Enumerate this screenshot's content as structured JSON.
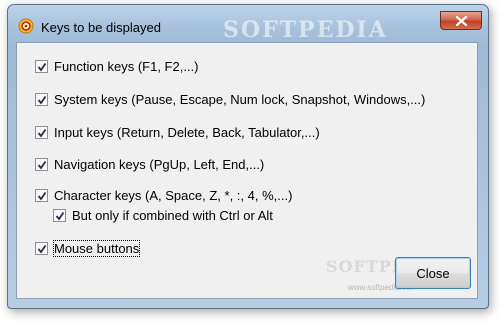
{
  "window": {
    "title": "Keys to be displayed"
  },
  "options": [
    {
      "label": "Function keys (F1, F2,...)",
      "checked": true
    },
    {
      "label": "System keys (Pause, Escape, Num lock, Snapshot, Windows,...)",
      "checked": true
    },
    {
      "label": "Input keys (Return, Delete, Back, Tabulator,...)",
      "checked": true
    },
    {
      "label": "Navigation keys (PgUp, Left, End,...)",
      "checked": true
    },
    {
      "label": "Character keys (A, Space, Z, *, :, 4, %,...)",
      "checked": true
    },
    {
      "label": "But only if combined with Ctrl or Alt",
      "checked": true
    },
    {
      "label": "Mouse buttons",
      "checked": true
    }
  ],
  "buttons": {
    "close_label": "Close"
  },
  "watermark": {
    "top": "SOFTPEDIA",
    "bottom": "SOFTPEDIA",
    "url": "www.softpedia.com"
  },
  "colors": {
    "title_bar": "#a7c1dc",
    "close_button": "#c0412a",
    "client_bg": "#f0f0f0"
  },
  "icons": {
    "app": "app-icon",
    "close": "close-icon",
    "check": "checkmark-icon"
  }
}
